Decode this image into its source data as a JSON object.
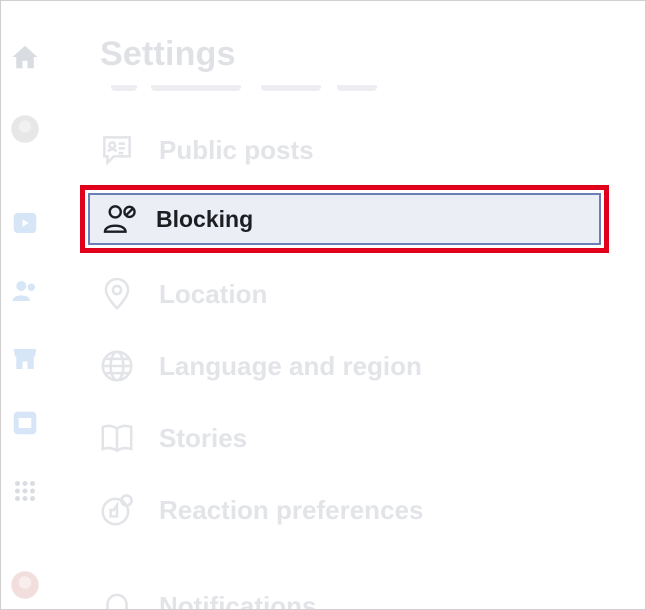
{
  "page": {
    "title": "Settings"
  },
  "menu": {
    "items": [
      {
        "label": "Public posts",
        "icon": "public-posts-icon"
      },
      {
        "label": "Blocking",
        "icon": "blocking-icon",
        "selected": true
      },
      {
        "label": "Location",
        "icon": "location-pin-icon"
      },
      {
        "label": "Language and region",
        "icon": "globe-icon"
      },
      {
        "label": "Stories",
        "icon": "book-icon"
      },
      {
        "label": "Reaction preferences",
        "icon": "reaction-icon"
      },
      {
        "label": "Notifications",
        "icon": "bell-icon"
      }
    ]
  },
  "rail": {
    "items": [
      "home-icon",
      "profile-avatar",
      "watch-icon",
      "friends-icon",
      "marketplace-icon",
      "gaming-icon",
      "menu-grid-icon",
      "profile-avatar-small"
    ]
  },
  "colors": {
    "highlight_border": "#e0001b",
    "selected_bg": "#eceef6",
    "faded_text": "#e2e4e8"
  }
}
